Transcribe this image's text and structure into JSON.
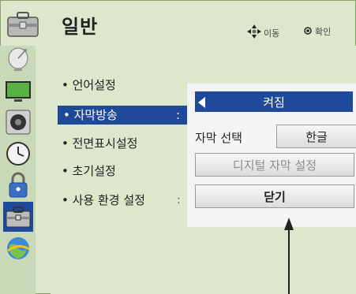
{
  "header": {
    "title": "일반",
    "move_hint": "이동",
    "ok_hint": "확인"
  },
  "menu": {
    "items": [
      {
        "label": "• 언어설정"
      },
      {
        "label": "• 자막방송",
        "colon": ":"
      },
      {
        "label": "• 전면표시설정"
      },
      {
        "label": "• 초기설정"
      },
      {
        "label": "• 사용 환경 설정",
        "colon": ":"
      }
    ]
  },
  "popup": {
    "header_value": "켜짐",
    "caption_label": "자막 선택",
    "caption_value": "한글",
    "digital_button": "디지털 자막 설정",
    "close_button": "닫기"
  },
  "colors": {
    "selected_blue": "#1e4a99",
    "background": "#dde7cb"
  },
  "icons": {
    "header": "toolbox-icon",
    "categories": [
      "satellite-dish-icon",
      "tv-screen-icon",
      "speaker-icon",
      "clock-icon",
      "lock-icon",
      "toolbox-icon",
      "globe-icon"
    ]
  }
}
